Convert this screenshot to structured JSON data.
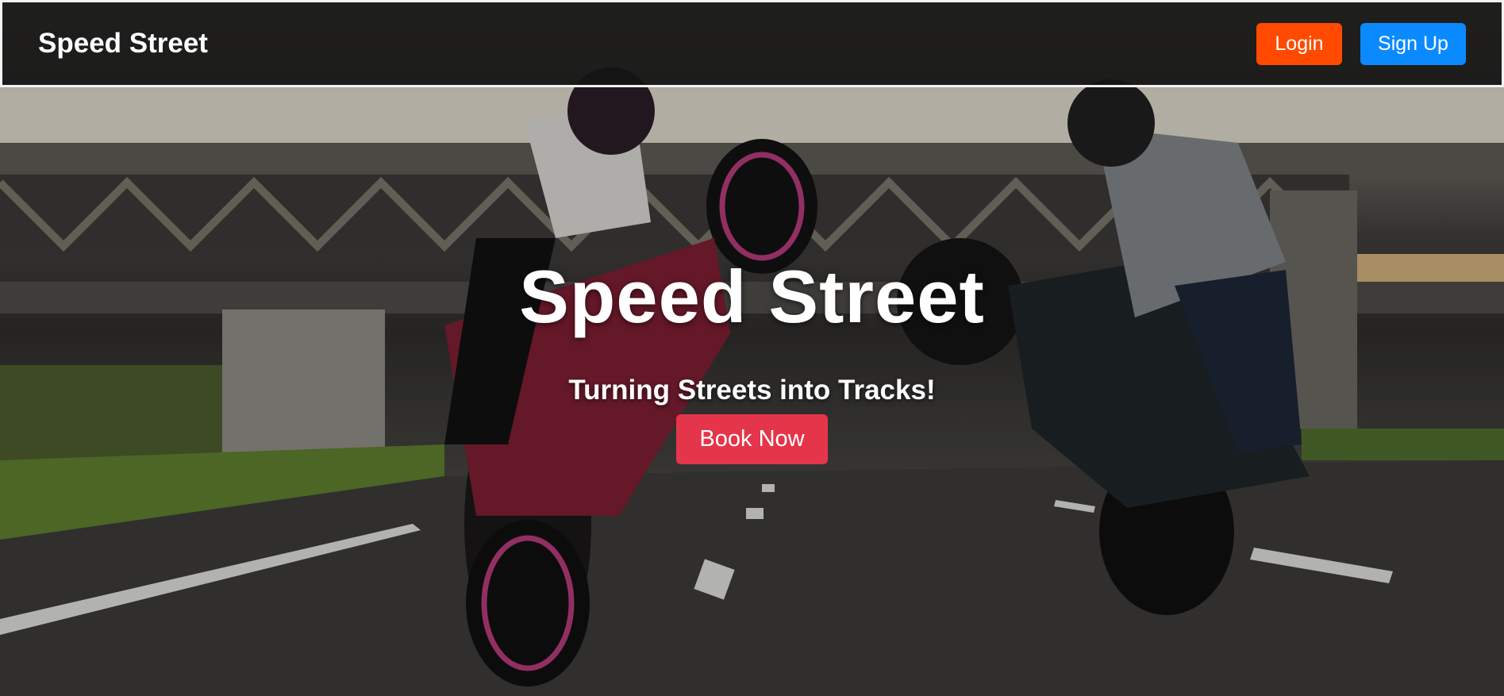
{
  "navbar": {
    "brand": "Speed Street",
    "login_label": "Login",
    "signup_label": "Sign Up"
  },
  "hero": {
    "title": "Speed Street",
    "subtitle": "Turning Streets into Tracks!",
    "cta_label": "Book Now"
  },
  "colors": {
    "login": "#ff4a00",
    "signup": "#0b8aff",
    "book": "#e5354a",
    "navbar_bg": "#141414"
  }
}
